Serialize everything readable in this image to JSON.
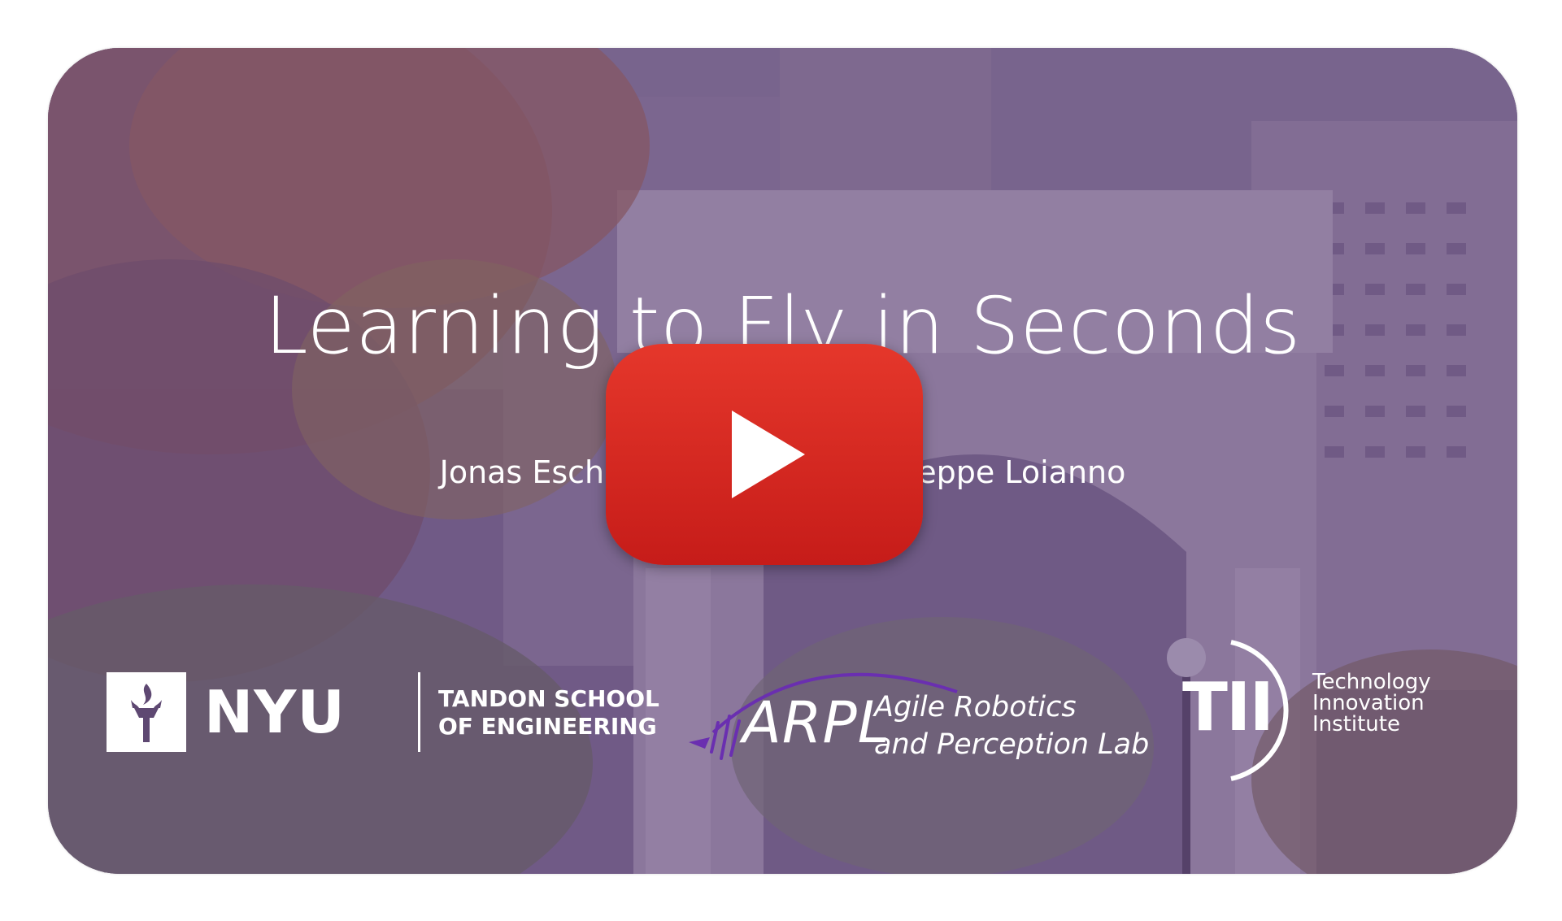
{
  "video": {
    "title": "Learning to Fly in Seconds",
    "authors": "Jonas Eschmann, Dong Li, Giuseppe Loianno",
    "play_icon": "play-icon",
    "colors": {
      "overlay": "#60467a",
      "play_red": "#e22b23",
      "text": "#ffffff"
    }
  },
  "logos": {
    "nyu": {
      "mark_icon": "torch-icon",
      "word": "NYU",
      "school_line1": "TANDON SCHOOL",
      "school_line2": "OF ENGINEERING"
    },
    "arpl": {
      "mark_icon": "wave-icon",
      "word": "ARPL",
      "name_line1": "Agile Robotics",
      "name_line2": "and Perception Lab"
    },
    "tii": {
      "word": "TII",
      "name_line1": "Technology",
      "name_line2": "Innovation",
      "name_line3": "Institute"
    }
  }
}
